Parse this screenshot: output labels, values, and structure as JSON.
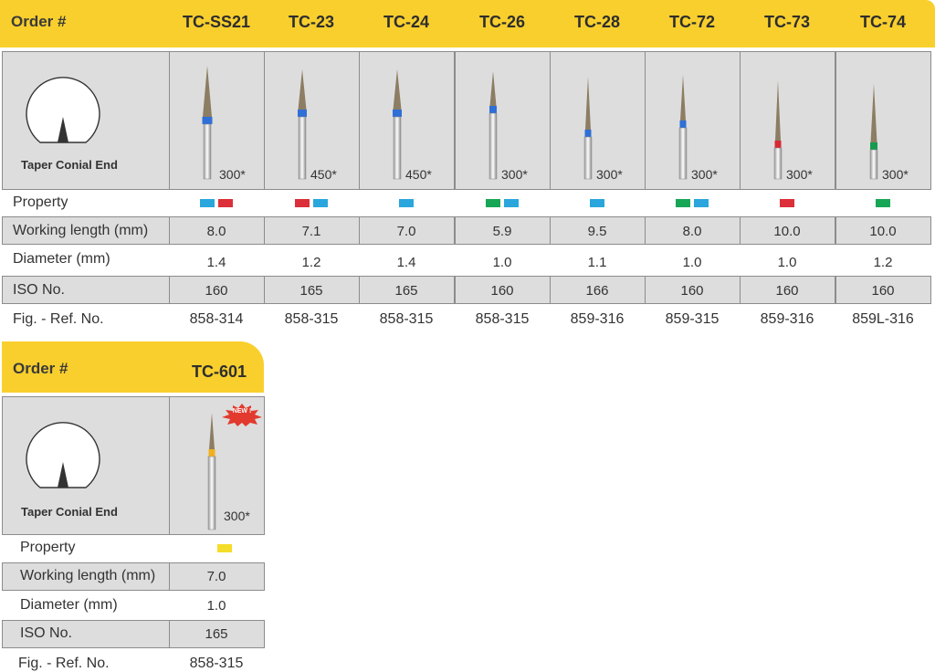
{
  "table1": {
    "order_label": "Order #",
    "codes": [
      "TC-SS21",
      "TC-23",
      "TC-24",
      "TC-26",
      "TC-28",
      "TC-72",
      "TC-73",
      "TC-74"
    ],
    "image_caption": "Taper Conial End",
    "speeds": [
      "300*",
      "450*",
      "450*",
      "300*",
      "300*",
      "300*",
      "300*",
      "300*"
    ],
    "band_colors": [
      "#2f6fd6",
      "#2f6fd6",
      "#2f6fd6",
      "#2f6fd6",
      "#2f6fd6",
      "#2f6fd6",
      "#d62b35",
      "#169b50"
    ],
    "labels": {
      "property": "Property",
      "working_length": "Working length (mm)",
      "diameter": "Diameter (mm)",
      "iso": "ISO No.",
      "ref": "Fig. - Ref. No."
    },
    "property_colors": [
      [
        "#2aa6dd",
        "#dc2f3a"
      ],
      [
        "#dc2f3a",
        "#2aa6dd"
      ],
      [
        "#2aa6dd"
      ],
      [
        "#17a655",
        "#2aa6dd"
      ],
      [
        "#2aa6dd"
      ],
      [
        "#17a655",
        "#2aa6dd"
      ],
      [
        "#dc2f3a"
      ],
      [
        "#17a655"
      ]
    ],
    "working_length": [
      "8.0",
      "7.1",
      "7.0",
      "5.9",
      "9.5",
      "8.0",
      "10.0",
      "10.0"
    ],
    "diameter": [
      "1.4",
      "1.2",
      "1.4",
      "1.0",
      "1.1",
      "1.0",
      "1.0",
      "1.2"
    ],
    "iso": [
      "160",
      "165",
      "165",
      "160",
      "166",
      "160",
      "160",
      "160"
    ],
    "ref": [
      "858-314",
      "858-315",
      "858-315",
      "858-315",
      "859-316",
      "859-315",
      "859-316",
      "859L-316"
    ]
  },
  "table2": {
    "order_label": "Order #",
    "code": "TC-601",
    "image_caption": "Taper Conial End",
    "new_badge": "NEW !",
    "speed": "300*",
    "band_color": "#f2b01c",
    "labels": {
      "property": "Property",
      "working_length": "Working length (mm)",
      "diameter": "Diameter (mm)",
      "iso": "ISO No.",
      "ref": "Fig. - Ref. No."
    },
    "property_color": "#f4dd2a",
    "working_length": "7.0",
    "diameter": "1.0",
    "iso": "165",
    "ref": "858-315"
  }
}
